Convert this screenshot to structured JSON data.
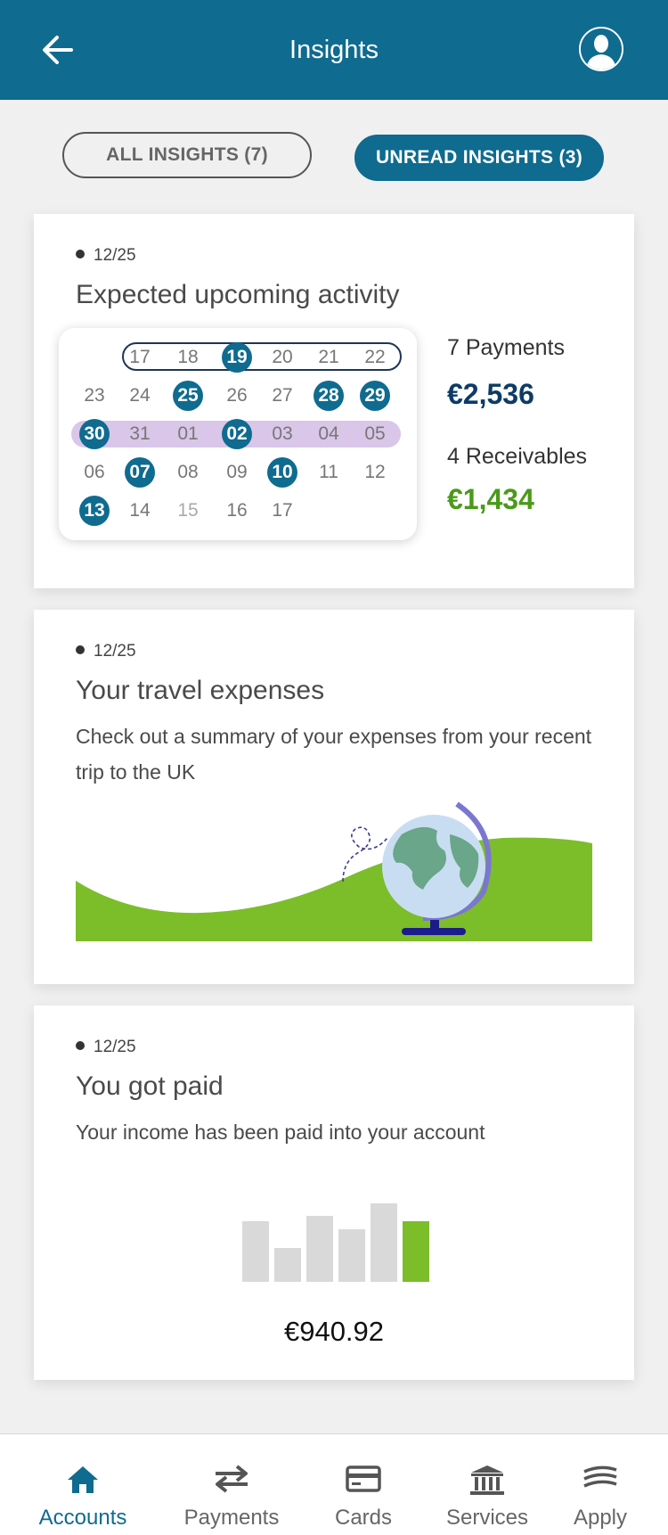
{
  "header": {
    "title": "Insights"
  },
  "tabs": [
    {
      "label": "ALL INSIGHTS (7)",
      "active": false
    },
    {
      "label": "UNREAD INSIGHTS (3)",
      "active": true
    }
  ],
  "cards": {
    "activity": {
      "date": "12/25",
      "title": "Expected upcoming activity",
      "payments_label": "7 Payments",
      "payments_amount": "€2,536",
      "receivables_label": "4 Receivables",
      "receivables_amount": "€1,434",
      "calendar_rows": [
        [
          {
            "d": "17"
          },
          {
            "d": "18"
          },
          {
            "d": "19",
            "hl": true
          },
          {
            "d": "20"
          },
          {
            "d": "21"
          },
          {
            "d": "22"
          }
        ],
        [
          {
            "d": "23"
          },
          {
            "d": "24"
          },
          {
            "d": "25",
            "hl": true
          },
          {
            "d": "26"
          },
          {
            "d": "27"
          },
          {
            "d": "28",
            "hl": true
          },
          {
            "d": "29",
            "hl": true
          }
        ],
        [
          {
            "d": "30",
            "hl": true
          },
          {
            "d": "31"
          },
          {
            "d": "01"
          },
          {
            "d": "02",
            "hl": true
          },
          {
            "d": "03"
          },
          {
            "d": "04"
          },
          {
            "d": "05"
          }
        ],
        [
          {
            "d": "06"
          },
          {
            "d": "07",
            "hl": true
          },
          {
            "d": "08"
          },
          {
            "d": "09"
          },
          {
            "d": "10",
            "hl": true
          },
          {
            "d": "11"
          },
          {
            "d": "12"
          }
        ],
        [
          {
            "d": "13",
            "hl": true
          },
          {
            "d": "14"
          },
          {
            "d": "15",
            "faded": true
          },
          {
            "d": "16"
          },
          {
            "d": "17"
          }
        ]
      ]
    },
    "travel": {
      "date": "12/25",
      "title": "Your travel expenses",
      "text": "Check out a summary of your expenses from your recent trip to the UK"
    },
    "paid": {
      "date": "12/25",
      "title": "You got paid",
      "text": "Your income has been paid into your account",
      "amount": "€940.92",
      "bars": [
        68,
        38,
        74,
        59,
        88,
        68
      ],
      "bar_colors": [
        "#d9d9d9",
        "#d9d9d9",
        "#d9d9d9",
        "#d9d9d9",
        "#d9d9d9",
        "#7cbd2a"
      ]
    }
  },
  "nav": [
    {
      "label": "Accounts",
      "icon": "home-icon",
      "active": true
    },
    {
      "label": "Payments",
      "icon": "transfer-arrows-icon",
      "active": false
    },
    {
      "label": "Cards",
      "icon": "card-icon",
      "active": false
    },
    {
      "label": "Services",
      "icon": "bank-icon",
      "active": false
    },
    {
      "label": "Apply",
      "icon": "stack-icon",
      "active": false
    }
  ],
  "colors": {
    "primary": "#0f6b8f",
    "payments_amount": "#0d3b66",
    "receivables_amount": "#4a9a1a",
    "green": "#7cbd2a",
    "range_highlight": "#d9c6e8"
  }
}
